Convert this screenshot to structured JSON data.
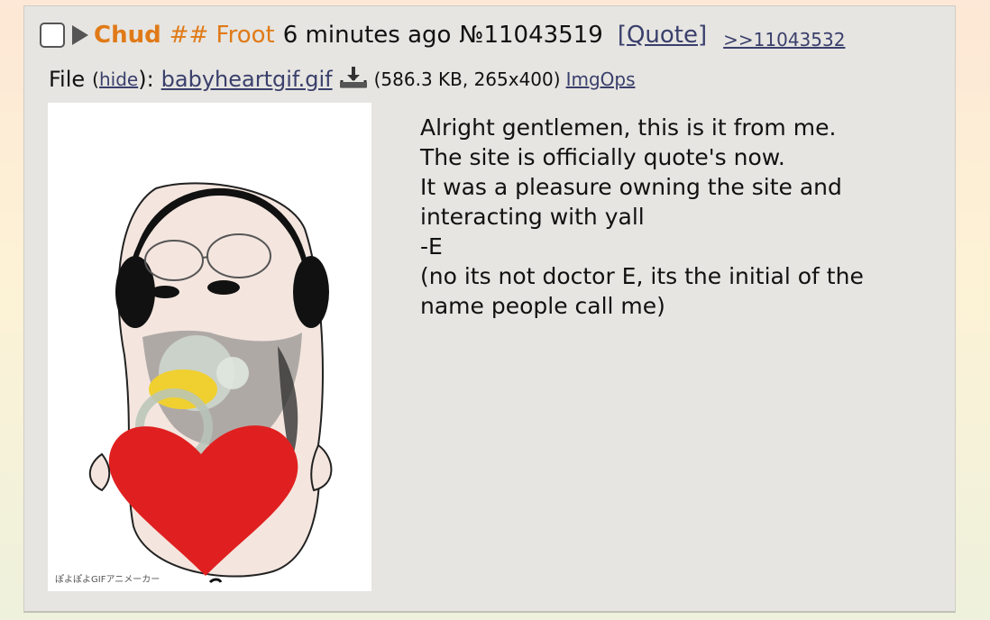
{
  "post": {
    "name": "Chud",
    "tripcode": "## Froot",
    "time": "6 minutes ago",
    "number": "№11043519",
    "quote_label": "[Quote]",
    "backlink": ">>11043532"
  },
  "file": {
    "label": "File",
    "open_paren": "(",
    "hide_label": "hide",
    "close_colon": "):",
    "name": "babyheartgif.gif",
    "meta": "(586.3 KB, 265x400)",
    "imgops_label": "ImgOps",
    "icon": "download-icon",
    "watermark": "ぽよぽよGIFアニメーカー"
  },
  "message": {
    "lines": [
      "Alright gentlemen, this is it from me.",
      "The site is officially quote's now.",
      "It was a pleasure owning the site and",
      "interacting with yall",
      "-E",
      "(no its not doctor E, its the initial of the",
      "name people call me)"
    ]
  },
  "colors": {
    "name": "#e07a17",
    "link": "#3a3f6c",
    "post_background": "#e6e5e1"
  }
}
